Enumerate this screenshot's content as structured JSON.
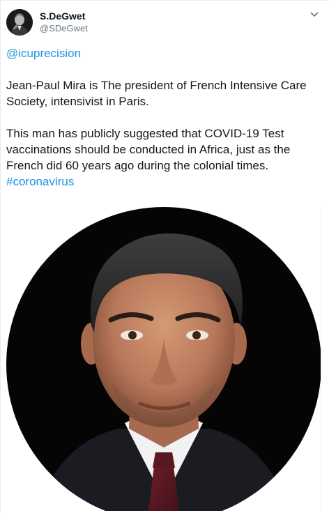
{
  "tweet": {
    "author": {
      "display_name": "S.DeGwet",
      "handle": "@SDeGwet"
    },
    "mention": "@icuprecision",
    "paragraph1": "Jean-Paul Mira is The president of French Intensive Care Society, intensivist in Paris.",
    "paragraph2": "This man has publicly suggested that COVID-19 Test vaccinations should be conducted in Africa, just as the French did 60 years ago during the colonial times.",
    "hashtag": "#coronavirus"
  },
  "icons": {
    "more": "chevron-down-icon",
    "avatar": "profile-avatar"
  },
  "colors": {
    "link": "#1b95e0",
    "text": "#14171a",
    "secondary": "#657786"
  }
}
